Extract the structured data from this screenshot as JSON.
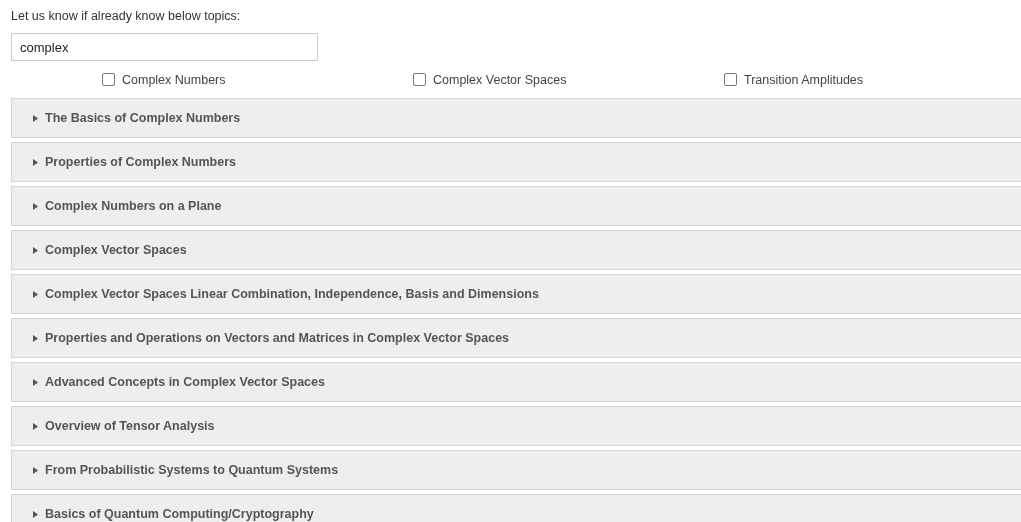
{
  "prompt": "Let us know if already know below topics:",
  "search": {
    "value": "complex"
  },
  "topics": [
    {
      "label": "Complex Numbers",
      "checked": false
    },
    {
      "label": "Complex Vector Spaces",
      "checked": false
    },
    {
      "label": "Transition Amplitudes",
      "checked": false
    }
  ],
  "sections": [
    {
      "title": "The Basics of Complex Numbers",
      "expanded": false
    },
    {
      "title": "Properties of Complex Numbers",
      "expanded": false
    },
    {
      "title": "Complex Numbers on a Plane",
      "expanded": false
    },
    {
      "title": "Complex Vector Spaces",
      "expanded": false
    },
    {
      "title": "Complex Vector Spaces Linear Combination, Independence, Basis and Dimensions",
      "expanded": false
    },
    {
      "title": "Properties and Operations on Vectors and Matrices in Complex Vector Spaces",
      "expanded": false
    },
    {
      "title": "Advanced Concepts in Complex Vector Spaces",
      "expanded": false
    },
    {
      "title": "Overview of Tensor Analysis",
      "expanded": false
    },
    {
      "title": "From Probabilistic Systems to Quantum Systems",
      "expanded": false
    },
    {
      "title": "Basics of Quantum Computing/Cryptography",
      "expanded": false
    }
  ]
}
